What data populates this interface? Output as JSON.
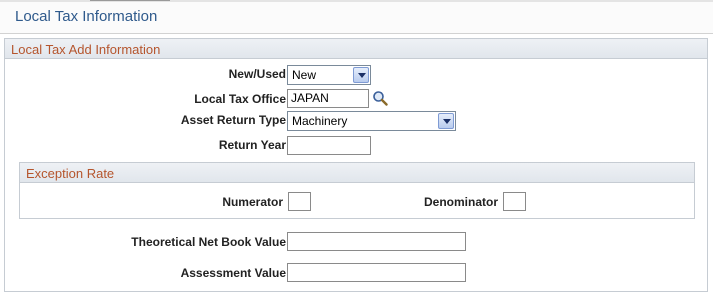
{
  "page": {
    "title": "Local Tax Information"
  },
  "group": {
    "title": "Local Tax Add Information"
  },
  "fields": {
    "new_used": {
      "label": "New/Used",
      "value": "New"
    },
    "local_tax_office": {
      "label": "Local Tax Office",
      "value": "JAPAN"
    },
    "asset_return_type": {
      "label": "Asset Return Type",
      "value": "Machinery"
    },
    "return_year": {
      "label": "Return Year",
      "value": ""
    },
    "theoretical_nbv": {
      "label": "Theoretical Net Book Value",
      "value": ""
    },
    "assessment_value": {
      "label": "Assessment Value",
      "value": ""
    }
  },
  "exception_rate": {
    "title": "Exception Rate",
    "numerator": {
      "label": "Numerator",
      "value": ""
    },
    "denominator": {
      "label": "Denominator",
      "value": ""
    }
  },
  "colors": {
    "page_title": "#2f5a8c",
    "section_title": "#b5552d",
    "header_bg": "#e6eaf0"
  }
}
